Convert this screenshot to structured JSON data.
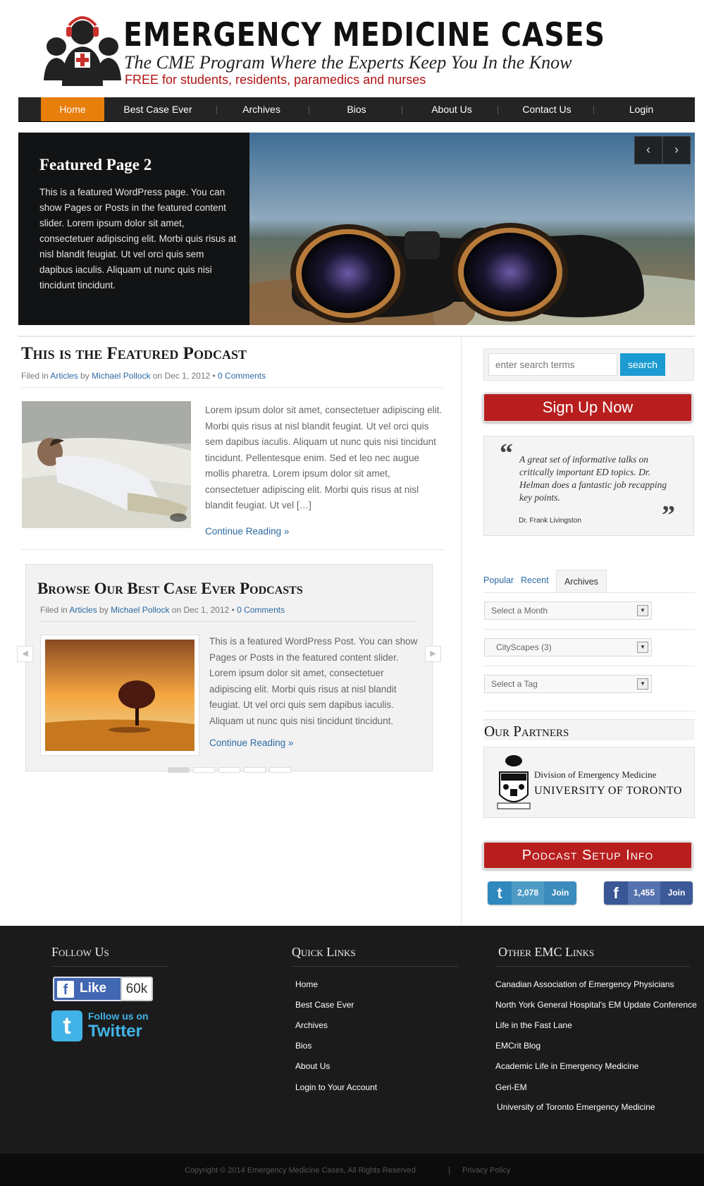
{
  "header": {
    "title": "EMERGENCY MEDICINE CASES",
    "tagline": "The CME Program Where the Experts Keep You In the Know",
    "free_line": "FREE for students, residents, paramedics and nurses"
  },
  "nav": {
    "items": [
      {
        "label": "Home"
      },
      {
        "label": "Best Case Ever"
      },
      {
        "label": "Archives"
      },
      {
        "label": "Bios"
      },
      {
        "label": "About Us"
      },
      {
        "label": "Contact Us"
      },
      {
        "label": "Login"
      }
    ]
  },
  "slider": {
    "title": "Featured Page 2",
    "text": "This is a featured WordPress page. You can show Pages or Posts in the featured content slider. Lorem ipsum dolor sit amet, consectetuer adipiscing elit. Morbi quis risus at nisl blandit feugiat. Ut vel orci quis sem dapibus iaculis. Aliquam ut nunc quis nisi tincidunt tincidunt.",
    "prev": "‹",
    "next": "›"
  },
  "post1": {
    "title": "This is the Featured Podcast",
    "filed_in": "Filed in",
    "category": "Articles",
    "by": "by",
    "author": "Michael Pollock",
    "on": "on Dec 1, 2012 •",
    "comments": "0 Comments",
    "body": "Lorem ipsum dolor sit amet, consectetuer adipiscing elit. Morbi quis risus at nisl blandit feugiat. Ut vel orci quis sem dapibus iaculis. Aliquam ut nunc quis nisi tincidunt tincidunt. Pellentesque enim. Sed et leo nec augue mollis pharetra. Lorem ipsum dolor sit amet, consectetuer adipiscing elit. Morbi quis risus at nisl blandit feugiat. Ut vel […]",
    "read_more": "Continue Reading »"
  },
  "post2": {
    "title": "Browse Our Best Case Ever Podcasts",
    "filed_in": "Filed in",
    "category": "Articles",
    "by": "by",
    "author": "Michael Pollock",
    "on": "on Dec 1, 2012 •",
    "comments": "0 Comments",
    "body": "This is a featured WordPress Post. You can show Pages or Posts in the featured content slider. Lorem ipsum dolor sit amet, consectetuer adipiscing elit. Morbi quis risus at nisl blandit feugiat. Ut vel orci quis sem dapibus iaculis. Aliquam ut nunc quis nisi tincidunt tincidunt.",
    "read_more": "Continue Reading »"
  },
  "sidebar": {
    "search_placeholder": "enter search terms",
    "search_button": "search",
    "signup": "Sign Up Now",
    "quote_open": "“",
    "quote_close": "”",
    "quote": "A great set of informative talks on critically important ED topics. Dr. Helman does a fantastic job recapping key points.",
    "quote_author": "Dr. Frank Livingston",
    "tabs": [
      "Popular",
      "Recent",
      "Archives"
    ],
    "select_month": "Select a Month",
    "select_category": "CityScapes  (3)",
    "select_tag": "Select a Tag",
    "partners_title": "Our Partners",
    "partner_division": "Division of Emergency Medicine",
    "partner_name": "UNIVERSITY OF TORONTO",
    "podcast_setup": "Podcast Setup Info",
    "twitter_count": "2,078",
    "facebook_count": "1,455",
    "join": "Join"
  },
  "footer": {
    "follow_title": "Follow Us",
    "like_label": "Like",
    "like_count": "60k",
    "follow_line1": "Follow us on",
    "follow_line2": "Twitter",
    "quick_title": "Quick Links",
    "quick_links": [
      "Home",
      "Best Case Ever",
      "Archives",
      "Bios",
      "About Us",
      "Login to Your Account"
    ],
    "other_title": "Other EMC Links",
    "other_links": [
      "Canadian Association of Emergency Physicians",
      "North York General Hospital's EM Update Conference",
      "Life in the Fast Lane",
      "EMCrit Blog",
      "Academic Life in Emergency Medicine",
      "Geri-EM",
      "University of Toronto Emergency Medicine"
    ],
    "copyright": "Copyright © 2014 Emergency Medicine Cases, All Rights Reserved",
    "separator": "|",
    "privacy": "Privacy Policy"
  },
  "colors": {
    "nav_active": "#e87e0c",
    "brand_red": "#b81e1e",
    "link_blue": "#2d6aa3",
    "search_blue": "#1b9bd1"
  }
}
